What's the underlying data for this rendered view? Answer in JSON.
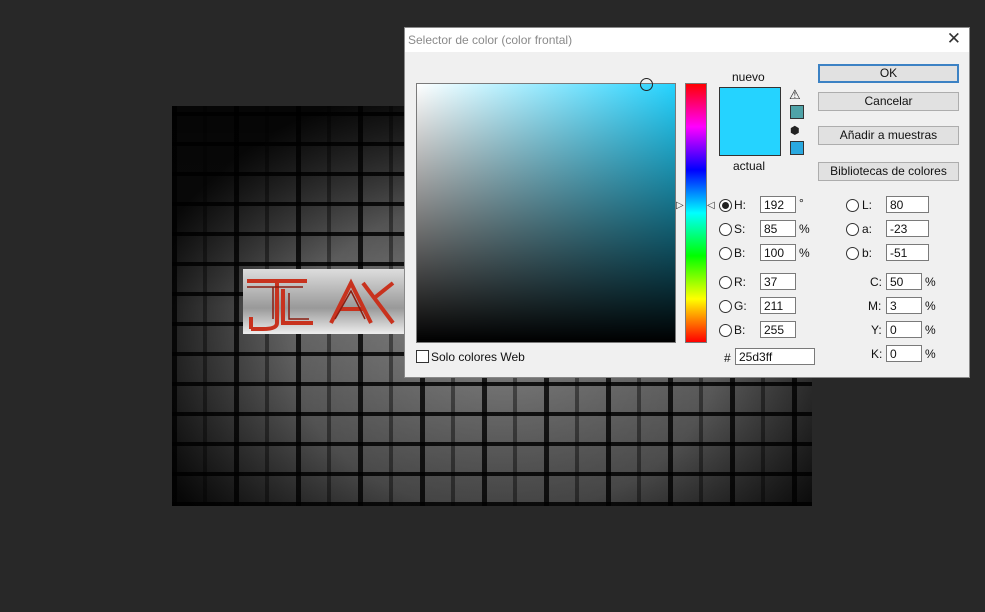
{
  "dialog": {
    "title": "Selector de color (color frontal)",
    "close": "✕",
    "nuevo": "nuevo",
    "actual": "actual",
    "buttons": {
      "ok": "OK",
      "cancel": "Cancelar",
      "add": "Añadir a muestras",
      "libraries": "Bibliotecas de colores"
    },
    "hsb": {
      "h": {
        "label": "H:",
        "value": "192",
        "unit": "°"
      },
      "s": {
        "label": "S:",
        "value": "85",
        "unit": "%"
      },
      "b": {
        "label": "B:",
        "value": "100",
        "unit": "%"
      }
    },
    "rgb": {
      "r": {
        "label": "R:",
        "value": "37"
      },
      "g": {
        "label": "G:",
        "value": "211"
      },
      "b": {
        "label": "B:",
        "value": "255"
      }
    },
    "lab": {
      "l": {
        "label": "L:",
        "value": "80"
      },
      "a": {
        "label": "a:",
        "value": "-23"
      },
      "b": {
        "label": "b:",
        "value": "-51"
      }
    },
    "cmyk": {
      "c": {
        "label": "C:",
        "value": "50",
        "unit": "%"
      },
      "m": {
        "label": "M:",
        "value": "3",
        "unit": "%"
      },
      "y": {
        "label": "Y:",
        "value": "0",
        "unit": "%"
      },
      "k": {
        "label": "K:",
        "value": "0",
        "unit": "%"
      }
    },
    "hex": {
      "label": "#",
      "value": "25d3ff"
    },
    "web_only": "Solo colores Web",
    "colors": {
      "current": "#25d3ff",
      "new": "#25d3ff",
      "warning_swatch": "#4fa3a8",
      "cube_swatch": "#2aa9e0"
    }
  }
}
